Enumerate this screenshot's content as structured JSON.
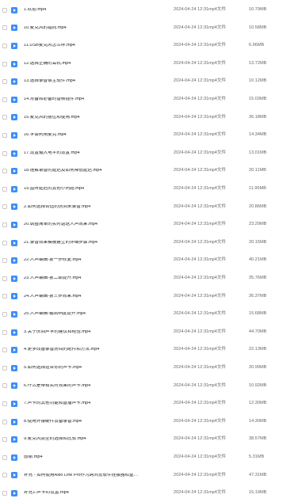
{
  "file_list": {
    "icon": "video-file-icon",
    "accent_color": "#3d8ff5",
    "rows": [
      {
        "name": "1.欢迎.mp4",
        "date": "2024-04-24 12:31",
        "type": "mp4文件",
        "size": "10.79MB"
      },
      {
        "name": "10.麦克风的指向.mp4",
        "date": "2024-04-24 12:31",
        "type": "mp4文件",
        "size": "10.58MB"
      },
      {
        "name": "11.USB麦克风怎么样.mp4",
        "date": "2024-04-24 12:31",
        "type": "mp4文件",
        "size": "6.96MB"
      },
      {
        "name": "12.选择正确的耳机.mp4",
        "date": "2024-04-24 12:31",
        "type": "mp4文件",
        "size": "13.72MB"
      },
      {
        "name": "13.选择录音宿主软件.mp4",
        "date": "2024-04-24 12:31",
        "type": "mp4文件",
        "size": "10.12MB"
      },
      {
        "name": "14.常备和必备的音频插件.mp4",
        "date": "2024-04-24 12:31",
        "type": "mp4文件",
        "size": "15.03MB"
      },
      {
        "name": "15.麦克风的摆位和使用.mp4",
        "date": "2024-04-24 12:31",
        "type": "mp4文件",
        "size": "36.18MB"
      },
      {
        "name": "16.学会利用麦克.mp4",
        "date": "2024-04-24 12:31",
        "type": "mp4文件",
        "size": "14.34MB"
      },
      {
        "name": "17.设置输入电平的设置.mp4",
        "date": "2024-04-24 12:31",
        "type": "mp4文件",
        "size": "13.01MB"
      },
      {
        "name": "18.理解录音的延迟及如何降低延迟.mp4",
        "date": "2024-04-24 12:31",
        "type": "mp4文件",
        "size": "20.11MB"
      },
      {
        "name": "19.监听延迟的其他小问题.mp4",
        "date": "2024-04-24 12:31",
        "type": "mp4文件",
        "size": "11.95MB"
      },
      {
        "name": "2.如何选择合适的房间来录音.mp4",
        "date": "2024-04-24 12:31",
        "type": "mp4文件",
        "size": "20.86MB"
      },
      {
        "name": "20.调整简单的实时返送人声效果.mp4",
        "date": "2024-04-24 12:31",
        "type": "mp4文件",
        "size": "23.29MB"
      },
      {
        "name": "21.录音效果模板建立的详细步骤.mp4",
        "date": "2024-04-24 12:31",
        "type": "mp4文件",
        "size": "20.15MB"
      },
      {
        "name": "22.人声编辑-第一步修复.mp4",
        "date": "2024-04-24 12:31",
        "type": "mp4文件",
        "size": "40.21MB"
      },
      {
        "name": "23.人声编辑-第二部提升.mp4",
        "date": "2024-04-24 12:31",
        "type": "mp4文件",
        "size": "35.76MB"
      },
      {
        "name": "24.人声编辑-第三步效果.mp4",
        "date": "2024-04-24 12:31",
        "type": "mp4文件",
        "size": "36.37MB"
      },
      {
        "name": "25.人声编辑-输出响度提升.mp4",
        "date": "2024-04-24 12:31",
        "type": "mp4文件",
        "size": "15.68MB"
      },
      {
        "name": "3.关于房间声学的建议和经验.mp4",
        "date": "2024-04-24 12:31",
        "type": "mp4文件",
        "size": "44.70MB"
      },
      {
        "name": "4.更多改善录音房间的配件和方法.mp4",
        "date": "2024-04-24 12:31",
        "type": "mp4文件",
        "size": "22.13MB"
      },
      {
        "name": "5.如何选择适合你的声卡.mp4",
        "date": "2024-04-24 12:31",
        "type": "mp4文件",
        "size": "20.99MB"
      },
      {
        "name": "6.什么是带有实时效果的声卡.mp4",
        "date": "2024-04-24 12:31",
        "type": "mp4文件",
        "size": "10.92MB"
      },
      {
        "name": "7.声卡的其他功能和直播声卡.mp4",
        "date": "2024-04-24 12:31",
        "type": "mp4文件",
        "size": "12.30MB"
      },
      {
        "name": "8.使用外接硬件设备录音.mp4",
        "date": "2024-04-24 12:31",
        "type": "mp4文件",
        "size": "14.30MB"
      },
      {
        "name": "9.麦克风类型的选择和比较.mp4",
        "date": "2024-04-24 12:31",
        "type": "mp4文件",
        "size": "38.57MB"
      },
      {
        "name": "感谢.mp4",
        "date": "2024-04-24 12:31",
        "type": "mp4文件",
        "size": "5.31MB"
      },
      {
        "name": "补充 - 如何使用Asio Link Pro作为跨浏览软件连接器和重…",
        "date": "2024-04-24 12:31",
        "type": "mp4文件",
        "size": "47.31MB"
      },
      {
        "name": "补充1-声卡IO设置.mp4",
        "date": "2024-04-24 12:31",
        "type": "mp4文件",
        "size": "15.19MB"
      }
    ]
  }
}
